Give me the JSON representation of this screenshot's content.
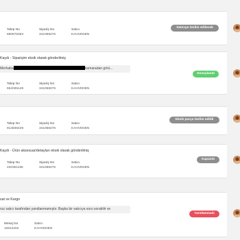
{
  "colors": {
    "grey_badge": "#8e8e8e",
    "green_badge": "#5fcf70",
    "red_badge": "#e8505b"
  },
  "tickets": [
    {
      "title": "",
      "message": "",
      "fields": [
        {
          "label": "Talep No",
          "value": "680675353"
        },
        {
          "label": "Sipariş No",
          "value": "341058276"
        },
        {
          "label": "Satıcı",
          "value": "KAHVEDEN"
        }
      ],
      "status": "Satıcıya teslim edilecek",
      "status_color": "grey"
    },
    {
      "title": "Kaydı - Siparişim eksik olarak gönderilmiş",
      "message_prefix": "Merhaba",
      "message_suffix": "numaradan görü...",
      "fields": [
        {
          "label": "Talep No",
          "value": "552035149"
        },
        {
          "label": "Sipariş No",
          "value": "341058276"
        },
        {
          "label": "Satıcı",
          "value": "KAHVEDEN"
        }
      ],
      "status": "Sonuçlandı",
      "status_color": "green"
    },
    {
      "title": "",
      "message": "",
      "fields": [
        {
          "label": "Talep No",
          "value": "914835429"
        },
        {
          "label": "Sipariş No",
          "value": "341058276"
        },
        {
          "label": "Satıcı",
          "value": "KAHVEDEN"
        }
      ],
      "status": "Eksik parça teslim edildi",
      "status_color": "grey"
    },
    {
      "title": "Kaydı - Ürün aksesuar/detayları eksik olarak gönderilmiş",
      "message": "",
      "fields": [
        {
          "label": "Talep No",
          "value": "220351185"
        },
        {
          "label": "Sipariş No",
          "value": "341058276"
        },
        {
          "label": "Satıcı",
          "value": "KAHVEDEN"
        }
      ],
      "status": "Kapandı",
      "status_color": "grey"
    },
    {
      "title": "sat ve Kargo",
      "message": "ruz satıcı tarafından yanıtlanmamıştır. Başka bir satıcıya soru sorabilir ve",
      "fields": [
        {
          "label": "Mesaj No",
          "value": "10612202"
        },
        {
          "label": "Satıcı",
          "value": "KAHVEDEN"
        }
      ],
      "status": "Yanıtlanmadı",
      "status_color": "red"
    }
  ]
}
